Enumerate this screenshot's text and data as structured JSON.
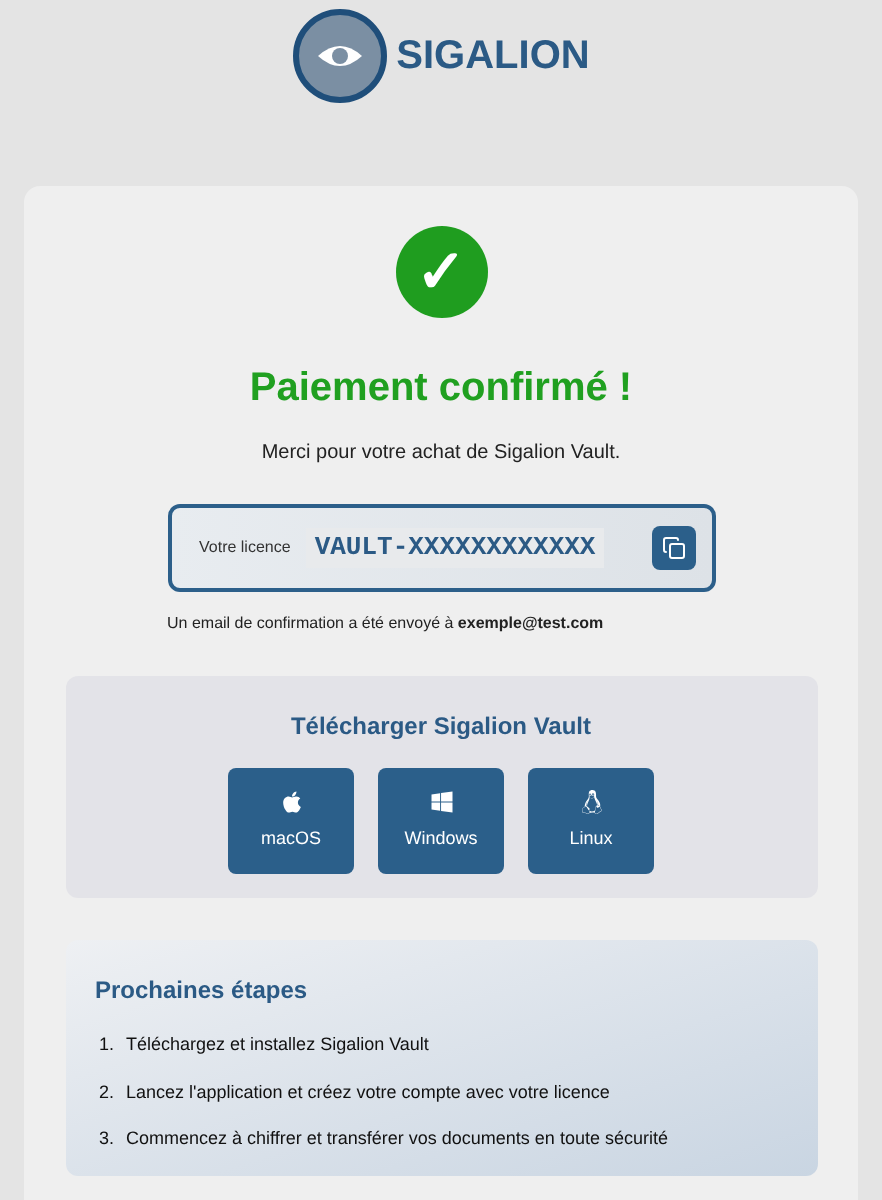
{
  "brand": {
    "name": "SIGALION"
  },
  "status": {
    "mark": "✓",
    "title": "Paiement confirmé !",
    "message": "Merci pour votre achat de Sigalion Vault."
  },
  "license": {
    "label": "Votre licence",
    "key": "VAULT-XXXXXXXXXXXX"
  },
  "email_note": "Un email de confirmation a été envoyé à **exemple@test.com**",
  "download": {
    "title": "Télécharger Sigalion Vault",
    "platforms": [
      {
        "kind": "apple",
        "label": "macOS"
      },
      {
        "kind": "windows",
        "label": "Windows"
      },
      {
        "kind": "linux",
        "label": "Linux"
      }
    ]
  },
  "next_steps": {
    "title": "Prochaines étapes",
    "steps": [
      {
        "number": "1.",
        "text": "Téléchargez et installez Sigalion Vault"
      },
      {
        "number": "2.",
        "text": "Lancez l'application et créez votre compte avec votre licence"
      },
      {
        "number": "3.",
        "text": "Commencez à chiffrer et transférer vos documents en toute sécurité"
      }
    ]
  }
}
